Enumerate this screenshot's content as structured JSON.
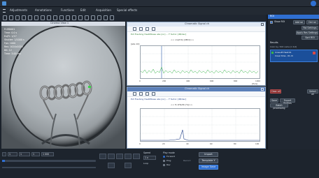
{
  "menu": {
    "items": [
      "Adjustments",
      "Annotations",
      "Functions",
      "Edit",
      "Acquisition",
      "Special effects"
    ]
  },
  "video": {
    "title": "Cinema View 1",
    "overlay_lines": [
      "Fr:M0001  ",
      "Time: 0.0 s",
      "Ex/Fr: 1/17",
      "Shutter: 1/1000 s",
      "Fps: 1000",
      "Res: 1024x1024",
      "Bit: 12",
      "Time: 3.00 ms"
    ]
  },
  "plot1": {
    "title": "Chromatic Signal ch",
    "legend": "Ext Flashing HeatMbase abs  [on]  ...   F factor [dB/dec]",
    "plot_title": "<< cos(fcb) [dBm]>>",
    "y_label": "[abs 10]",
    "x_unit": "[Hz/s]",
    "x_ticks": [
      "0",
      "200",
      "400",
      "600",
      "800",
      "1000"
    ]
  },
  "plot2": {
    "title": "Chromatic Signal ch",
    "legend": "Ext Flashing HeatMbase abs  [on]  ...   F factor [dB/dec]",
    "plot_title": "<< fx kHz/db [%]>>",
    "x_ticks": [
      "0",
      "20",
      "40",
      "60",
      "80",
      "100"
    ]
  },
  "right_panel": {
    "header": "ROI",
    "checkbox_label": "Show ROI",
    "add_btn": "Add roi",
    "del_btn": "Del roi",
    "settings_btn": "Roi Settings",
    "apply_btn": "Apply Res Settings",
    "sort_btn": "Sort ROI",
    "list_title": "Results",
    "list_sub": "Color by  / ROI name  [1 list]",
    "list_item_1": "Cross-Pt Heat:01 ",
    "list_item_2": "Cover time - 01 ch",
    "clear_btn": "Clear all",
    "select_btn": "Select all",
    "save_btn": "Save",
    "export_btn": "Export Profiles",
    "batch_btn": "Batch processing"
  },
  "bottom": {
    "frame_start": "1",
    "frame_end": "1 000",
    "step": "1",
    "current": "1",
    "speed_label": "Speed",
    "speed_value": "1 x",
    "loop_label": "Loop",
    "play_mode_label": "Play mode",
    "mode_forward": "Forward",
    "mode_pingpong": "Ping",
    "mode_reverse": "Rev",
    "record_label": "Record",
    "import_btn": "Import",
    "template_btn": "Template Y",
    "image_save_btn": "Image Save"
  }
}
